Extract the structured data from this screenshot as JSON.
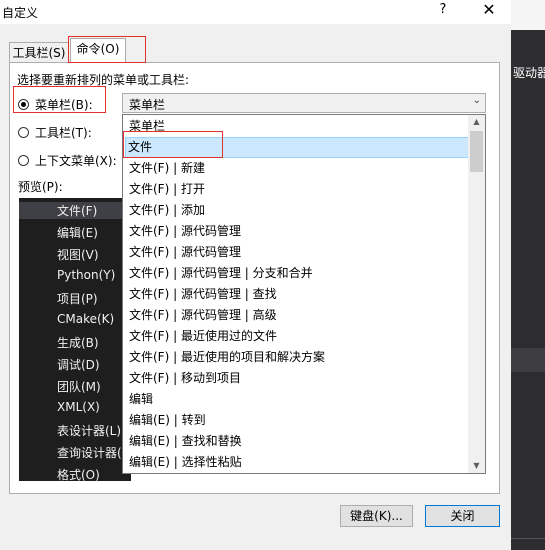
{
  "window": {
    "title": "自定义",
    "help_glyph": "?",
    "close_glyph": "✕"
  },
  "background": {
    "side_text": "驱动器"
  },
  "tabs": [
    {
      "label": "工具栏(S)"
    },
    {
      "label": "命令(O)"
    }
  ],
  "instruction": "选择要重新排列的菜单或工具栏:",
  "radios": [
    {
      "label": "菜单栏(B):",
      "checked": true
    },
    {
      "label": "工具栏(T):",
      "checked": false
    },
    {
      "label": "上下文菜单(X):",
      "checked": false
    }
  ],
  "combo": {
    "value": "菜单栏"
  },
  "preview": {
    "label": "预览(P):",
    "items": [
      "文件(F)",
      "编辑(E)",
      "视图(V)",
      "Python(Y)",
      "项目(P)",
      "CMake(K)",
      "生成(B)",
      "调试(D)",
      "团队(M)",
      "XML(X)",
      "表设计器(L)",
      "查询设计器(",
      "格式(O)"
    ]
  },
  "dropdown": {
    "items": [
      "菜单栏",
      "文件",
      "文件(F) | 新建",
      "文件(F) | 打开",
      "文件(F) | 添加",
      "文件(F) | 源代码管理",
      "文件(F) | 源代码管理",
      "文件(F) | 源代码管理 | 分支和合并",
      "文件(F) | 源代码管理 | 查找",
      "文件(F) | 源代码管理 | 高级",
      "文件(F) | 最近使用过的文件",
      "文件(F) | 最近使用的项目和解决方案",
      "文件(F) | 移动到项目",
      "编辑",
      "编辑(E) | 转到",
      "编辑(E) | 查找和替换",
      "编辑(E) | 选择性粘贴"
    ],
    "selected_index": 1
  },
  "buttons": {
    "keyboard": "键盘(K)...",
    "close": "关闭"
  },
  "colors": {
    "annotation": "#e03030",
    "selection": "#cce8ff",
    "accent": "#0078d7"
  }
}
